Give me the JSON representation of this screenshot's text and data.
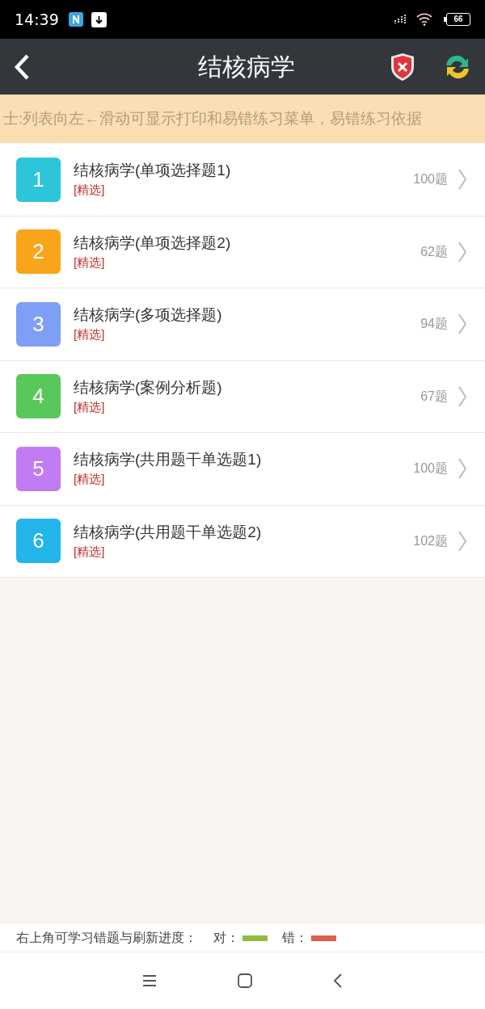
{
  "status_bar": {
    "time": "14:39",
    "battery": "66"
  },
  "header": {
    "title": "结核病学"
  },
  "tip": "士:列表向左←滑动可显示打印和易错练习菜单，易错练习依据",
  "items": [
    {
      "number": "1",
      "title": "结核病学(单项选择题1)",
      "tag": "[精选]",
      "count": "100题",
      "color": "#2cc5da"
    },
    {
      "number": "2",
      "title": "结核病学(单项选择题2)",
      "tag": "[精选]",
      "count": "62题",
      "color": "#f8a51c"
    },
    {
      "number": "3",
      "title": "结核病学(多项选择题)",
      "tag": "[精选]",
      "count": "94题",
      "color": "#7f9ff7"
    },
    {
      "number": "4",
      "title": "结核病学(案例分析题)",
      "tag": "[精选]",
      "count": "67题",
      "color": "#58c85b"
    },
    {
      "number": "5",
      "title": "结核病学(共用题干单选题1)",
      "tag": "[精选]",
      "count": "100题",
      "color": "#c17cf3"
    },
    {
      "number": "6",
      "title": "结核病学(共用题干单选题2)",
      "tag": "[精选]",
      "count": "102题",
      "color": "#23b5e9"
    }
  ],
  "legend": {
    "text": "右上角可学习错题与刷新进度：",
    "items": [
      {
        "label": "对：",
        "color": "#8fbc3f"
      },
      {
        "label": "错：",
        "color": "#e0604c"
      }
    ]
  }
}
